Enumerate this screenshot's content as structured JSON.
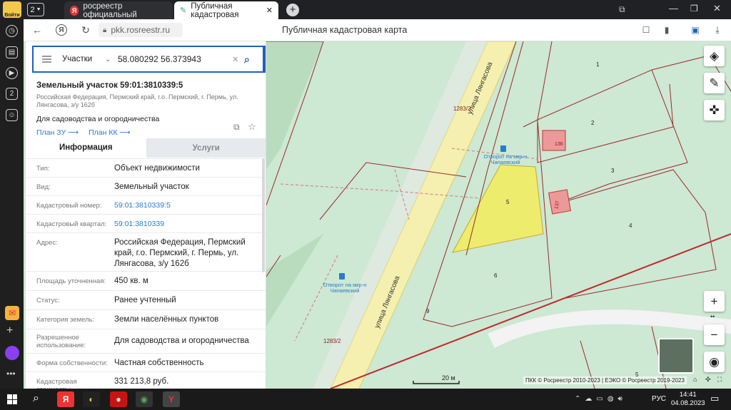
{
  "browser": {
    "login_label": "Войти",
    "tab_count": "2",
    "tabs": [
      {
        "title": "росреестр официальный",
        "active": false
      },
      {
        "title": "Публичная кадастровая",
        "active": true
      }
    ],
    "url": "pkk.rosreestr.ru",
    "page_title": "Публичная кадастровая карта",
    "sidebar_badge": "2"
  },
  "search": {
    "category": "Участки",
    "query": "58.080292 56.373943"
  },
  "parcel": {
    "title": "Земельный участок 59:01:3810339:5",
    "address_line": "Российская Федерация, Пермский край, г.о. Пермский, г. Пермь, ул. Лянгасова, з/у 162б",
    "purpose": "Для садоводства и огородничества",
    "plan_zu": "План ЗУ",
    "plan_kk": "План КК"
  },
  "tabs": {
    "info": "Информация",
    "services": "Услуги"
  },
  "fields": [
    {
      "label": "Тип:",
      "value": "Объект недвижимости",
      "link": false
    },
    {
      "label": "Вид:",
      "value": "Земельный участок",
      "link": false
    },
    {
      "label": "Кадастровый номер:",
      "value": "59:01:3810339:5",
      "link": true
    },
    {
      "label": "Кадастровый квартал:",
      "value": "59:01:3810339",
      "link": true
    },
    {
      "label": "Адрес:",
      "value": "Российская Федерация, Пермский край, г.о. Пермский, г. Пермь, ул. Лянгасова, з/у 162б",
      "link": false
    },
    {
      "label": "Площадь уточненная:",
      "value": "450 кв. м",
      "link": false
    },
    {
      "label": "Статус:",
      "value": "Ранее учтенный",
      "link": false
    },
    {
      "label": "Категория земель:",
      "value": "Земли населённых пунктов",
      "link": false
    },
    {
      "label": "Разрешенное использование:",
      "value": "Для садоводства и огородничества",
      "link": false
    },
    {
      "label": "Форма собственности:",
      "value": "Частная собственность",
      "link": false
    },
    {
      "label": "Кадастровая стоимость:",
      "value": "331 213,8 руб.",
      "link": false
    }
  ],
  "map": {
    "street_label": "улица Лянгасова",
    "bus_stop_top": "Отворот на мкр-н Чапаевский",
    "bus_stop_bottom": "Отворот на мкр-н Чапаевский",
    "labels": [
      "1",
      "2",
      "3",
      "4",
      "5",
      "6",
      "1283/2",
      "1283/2",
      "9",
      "5",
      "136",
      "137"
    ],
    "scale": "20 м",
    "copyright": "ПКК © Росреестр 2010-2023 | ЕЭКО © Росреестр 2019-2023"
  },
  "taskbar": {
    "lang": "РУС",
    "time": "14:41",
    "date": "04.08.2023"
  },
  "colors": {
    "search_bar": "#1f62b8",
    "parcel_highlight": "#f2ec5a",
    "boundary": "#9b2b2b",
    "map_bg": "#cde8d3"
  }
}
